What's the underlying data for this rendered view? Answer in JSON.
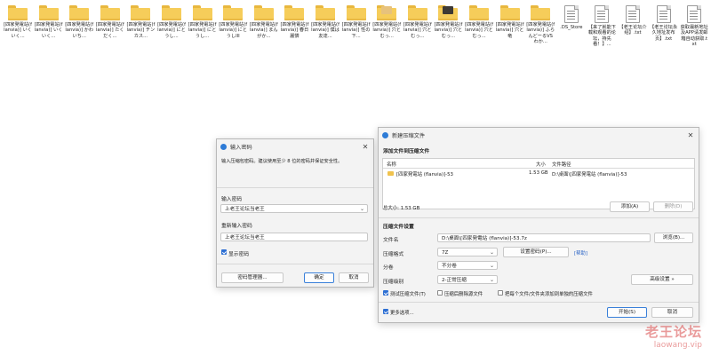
{
  "desktop": {
    "icons": [
      {
        "type": "folder",
        "label": "[四家発電站(flanvia)] いくいく..."
      },
      {
        "type": "folder",
        "label": "[四家発電站(flanvia)] いくいく..."
      },
      {
        "type": "folder",
        "label": "[四家発電站(flanvia)] かわいち..."
      },
      {
        "type": "folder",
        "label": "[四家発電站(flanvia)] たくだく..."
      },
      {
        "type": "folder",
        "label": "[四家発電站(flanvia)] チンカス..."
      },
      {
        "type": "folder",
        "label": "[四家発電站(flanvia)] にとうし..."
      },
      {
        "type": "folder",
        "label": "[四家発電站(flanvia)] にとうし..."
      },
      {
        "type": "folder",
        "label": "[四家発電站(flanvia)] にとうしIII"
      },
      {
        "type": "folder",
        "label": "[四家発電站(flanvia)] まんがか..."
      },
      {
        "type": "folder",
        "label": "[四家発電站(flanvia)] 春日麗憐"
      },
      {
        "type": "folder",
        "label": "[四家発電站(flanvia)] 僕は友達..."
      },
      {
        "type": "folder",
        "label": "[四家発電站(flanvia)] 性の下..."
      },
      {
        "type": "folder",
        "label": "[四家発電站(flanvia)] 穴とむっ...",
        "thumb": "#e7c27c"
      },
      {
        "type": "folder",
        "label": "[四家発電站(flanvia)] 穴とむっ..."
      },
      {
        "type": "folder",
        "label": "[四家発電站(flanvia)] 穴とむっ...",
        "thumb": "#3e3a35"
      },
      {
        "type": "folder",
        "label": "[四家発電站(flanvia)] 穴とむっ..."
      },
      {
        "type": "folder",
        "label": "[四家発電站(flanvia)] 穴と竜"
      },
      {
        "type": "folder",
        "label": "[四家発電站(flanvia)] ふらんどーるVSわか..."
      },
      {
        "type": "doc",
        "label": ".DS_Store"
      },
      {
        "type": "doc",
        "label": "【来了就能下载和观看的论坛，持先看！】..."
      },
      {
        "type": "doc",
        "label": "【老王论坛介绍】.txt"
      },
      {
        "type": "doc",
        "label": "【老王论坛永久地址发布页】.txt"
      },
      {
        "type": "doc",
        "label": "获取最新地址及APP请发邮箱自动获取.txt"
      }
    ]
  },
  "password_dialog": {
    "title": "输入密码",
    "hint": "输入压缩包密码。建议使用至少 8 位的密码并保证安全性。",
    "password_label": "输入密码",
    "password_value": "上老王论坛当老王",
    "reenter_label": "重新输入密码",
    "reenter_value": "上老王论坛当老王",
    "show_password": "显示密码",
    "manager_button": "密码管理器...",
    "ok_button": "确定",
    "cancel_button": "取消"
  },
  "archive_dialog": {
    "title": "新建压缩文件",
    "add_section": "添加文件到压缩文件",
    "col_name": "名称",
    "col_size": "大小",
    "col_path": "文件路径",
    "row_name": "[四家発電站 (flanvia)]-53",
    "row_size": "1.53 GB",
    "row_path": "D:\\桌面\\[四家発電站 (flanvia)]-53",
    "total": "总大小: 1.53 GB",
    "add_button": "添加(A)",
    "delete_button": "删除(D)",
    "settings_section": "压缩文件设置",
    "filename_label": "文件名",
    "filename_value": "D:\\桌面\\[四家発電站 (flanvia)]-53.7z",
    "browse_button": "浏览(B)...",
    "format_label": "压缩格式",
    "format_value": "7Z",
    "set_password_button": "设置密码(P)...",
    "help_link": "[帮助]",
    "volume_label": "分卷",
    "volume_value": "不分卷",
    "level_label": "压缩级别",
    "level_value": "2-正常压缩",
    "advanced_button": "高级设置 »",
    "test_option": "测试压缩文件(T)",
    "delete_option": "压缩后删除源文件",
    "each_option": "把每个文件/文件夹添加到单独的压缩文件",
    "more_options": "更多选项...",
    "start_button": "开始(S)",
    "cancel_button": "取消"
  },
  "watermark": {
    "line1": "老王论坛",
    "line2": "laowang.vip"
  },
  "colors": {
    "accent": "#2d6fd3",
    "folder": "#f6cd5a",
    "watermark": "#d94a4a"
  }
}
